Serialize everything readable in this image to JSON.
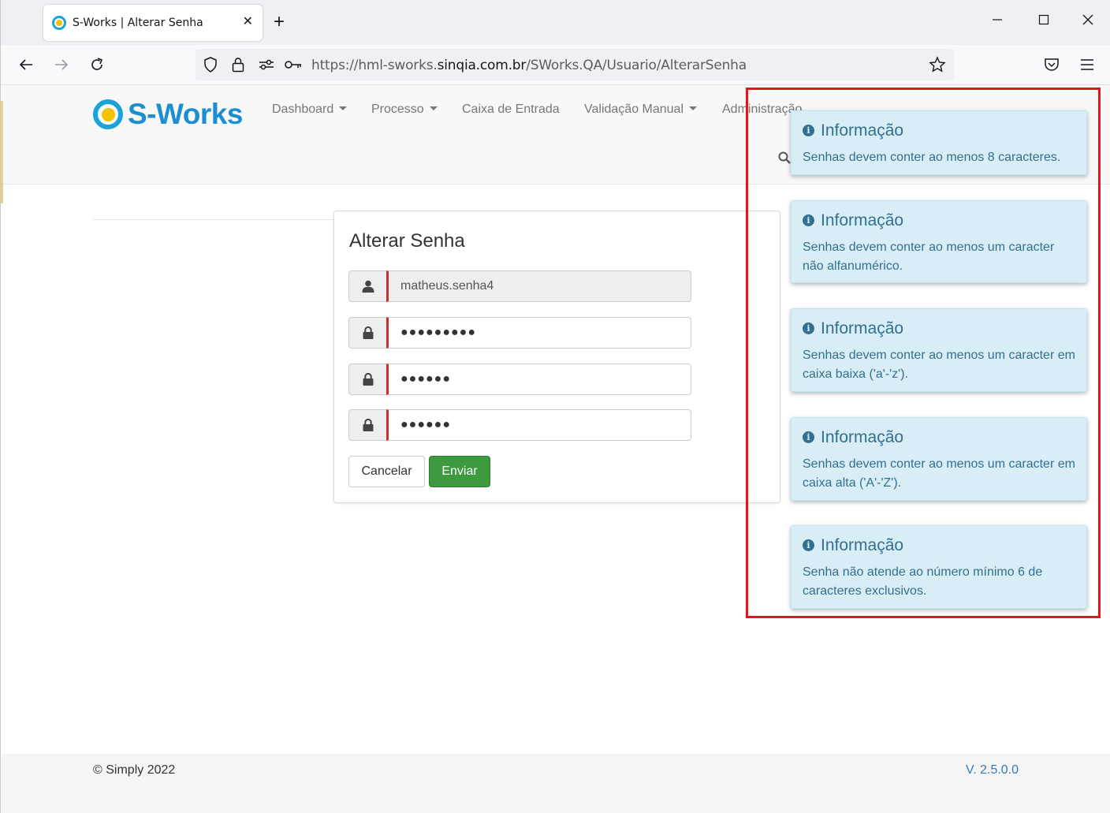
{
  "browser": {
    "tab_title": "S-Works | Alterar Senha",
    "url_prefix": "https://hml-sworks.",
    "url_domain": "sinqia.com.br",
    "url_path": "/SWorks.QA/Usuario/AlterarSenha"
  },
  "app": {
    "logo_text": "S-Works",
    "menu": {
      "dashboard": "Dashboard",
      "processo": "Processo",
      "caixa": "Caixa de Entrada",
      "validacao": "Validação Manual",
      "administracao": "Administração"
    }
  },
  "form": {
    "title": "Alterar Senha",
    "username": "matheus.senha4",
    "current_password": "●●●●●●●●●",
    "new_password": "●●●●●●",
    "confirm_password": "●●●●●●",
    "cancel_label": "Cancelar",
    "send_label": "Enviar"
  },
  "toasts": [
    {
      "title": "Informação",
      "message": "Senhas devem conter ao menos 8 caracteres."
    },
    {
      "title": "Informação",
      "message": "Senhas devem conter ao menos um caracter não alfanumérico."
    },
    {
      "title": "Informação",
      "message": "Senhas devem conter ao menos um caracter em caixa baixa ('a'-'z')."
    },
    {
      "title": "Informação",
      "message": "Senhas devem conter ao menos um caracter em caixa alta ('A'-'Z')."
    },
    {
      "title": "Informação",
      "message": "Senha não atende ao número mínimo 6 de caracteres exclusivos."
    }
  ],
  "footer": {
    "copyright": "© Simply 2022",
    "version": "V. 2.5.0.0"
  },
  "colors": {
    "brand": "#1d8fd0",
    "success": "#3e9a3e",
    "info_bg": "#d9edf7",
    "info_text": "#31708f",
    "highlight": "#e8141c"
  }
}
